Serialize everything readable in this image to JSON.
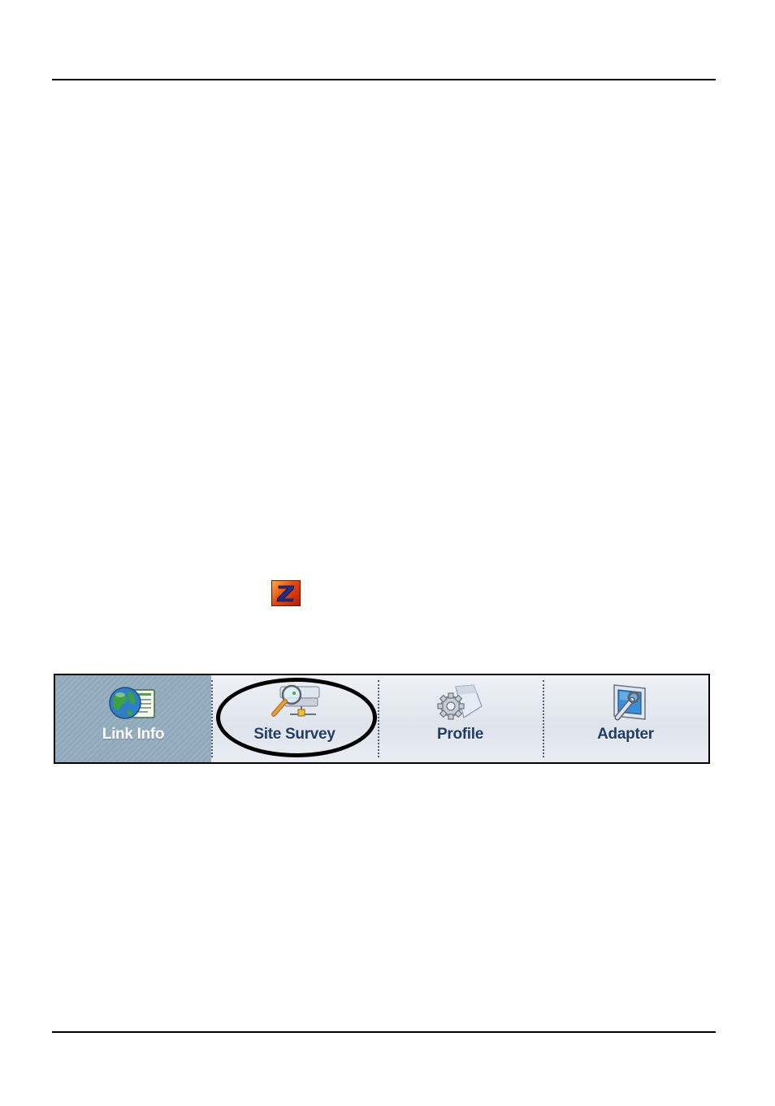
{
  "logo": {
    "letter": "Z",
    "icon": "zyxel-utility-z-icon"
  },
  "toolbar": {
    "tabs": [
      {
        "label": "Link Info",
        "icon": "globe-document-icon",
        "active": true
      },
      {
        "label": "Site Survey",
        "icon": "magnifier-network-icon",
        "active": false,
        "highlighted": true
      },
      {
        "label": "Profile",
        "icon": "gear-document-icon",
        "active": false
      },
      {
        "label": "Adapter",
        "icon": "wrench-adapter-icon",
        "active": false
      }
    ]
  },
  "colors": {
    "active_tab": "#8fa9bb",
    "tab_label_inactive": "#1f3d66",
    "z_icon": "#e84a10",
    "highlight": "#000000"
  }
}
